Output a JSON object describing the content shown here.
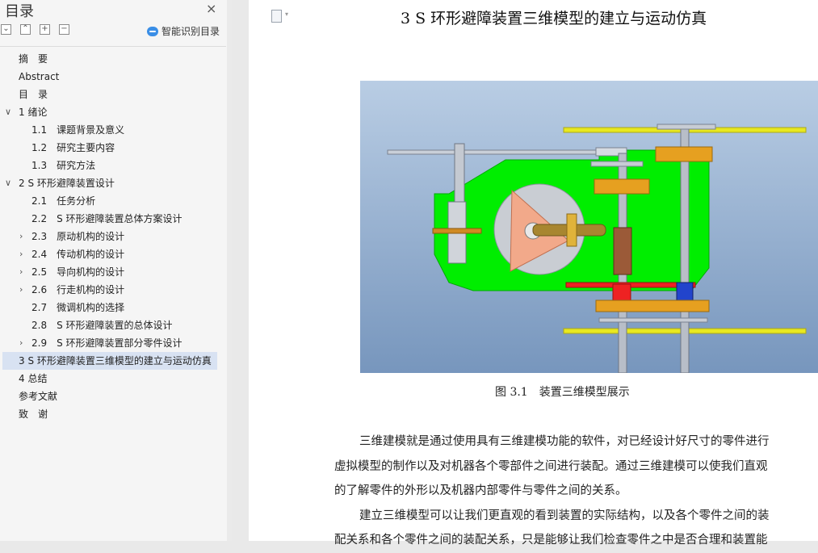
{
  "sidebar": {
    "title": "目录",
    "close_glyph": "×",
    "smart_label": "智能识别目录",
    "items": [
      {
        "label": "摘　要",
        "indent": 0,
        "caret": ""
      },
      {
        "label": "Abstract",
        "indent": 0,
        "caret": ""
      },
      {
        "label": "目　录",
        "indent": 0,
        "caret": ""
      },
      {
        "label": "1  绪论",
        "indent": 0,
        "caret": "open"
      },
      {
        "label": "1.1　课题背景及意义",
        "indent": 1,
        "caret": ""
      },
      {
        "label": "1.2　研究主要内容",
        "indent": 1,
        "caret": ""
      },
      {
        "label": "1.3　研究方法",
        "indent": 1,
        "caret": ""
      },
      {
        "label": "2  S 环形避障装置设计",
        "indent": 0,
        "caret": "open"
      },
      {
        "label": "2.1　任务分析",
        "indent": 1,
        "caret": ""
      },
      {
        "label": "2.2　S 环形避障装置总体方案设计",
        "indent": 1,
        "caret": ""
      },
      {
        "label": "2.3　原动机构的设计",
        "indent": 1,
        "caret": "closed"
      },
      {
        "label": "2.4　传动机构的设计",
        "indent": 1,
        "caret": "closed"
      },
      {
        "label": "2.5　导向机构的设计",
        "indent": 1,
        "caret": "closed"
      },
      {
        "label": "2.6　行走机构的设计",
        "indent": 1,
        "caret": "closed"
      },
      {
        "label": "2.7　微调机构的选择",
        "indent": 1,
        "caret": ""
      },
      {
        "label": "2.8　S 环形避障装置的总体设计",
        "indent": 1,
        "caret": ""
      },
      {
        "label": "2.9　S 环形避障装置部分零件设计",
        "indent": 1,
        "caret": "closed"
      },
      {
        "label": "3 S 环形避障装置三维模型的建立与运动仿真",
        "indent": 0,
        "caret": "",
        "active": true
      },
      {
        "label": "4 总结",
        "indent": 0,
        "caret": ""
      },
      {
        "label": "参考文献",
        "indent": 0,
        "caret": ""
      },
      {
        "label": "致　谢",
        "indent": 0,
        "caret": ""
      }
    ]
  },
  "document": {
    "heading": "3 S 环形避障装置三维模型的建立与运动仿真",
    "figure_caption": "图 3.1　装置三维模型展示",
    "paragraph_lines": [
      "三维建模就是通过使用具有三维建模功能的软件，对已经设计好尺寸的零件进行",
      "虚拟模型的制作以及对机器各个零部件之间进行装配。通过三维建模可以使我们直观",
      "的了解零件的外形以及机器内部零件与零件之间的关系。",
      "建立三维模型可以让我们更直观的看到装置的实际结构，以及各个零件之间的装",
      "配关系和各个零件之间的装配关系，只是能够让我们检查零件之中是否合理和装置能"
    ]
  }
}
